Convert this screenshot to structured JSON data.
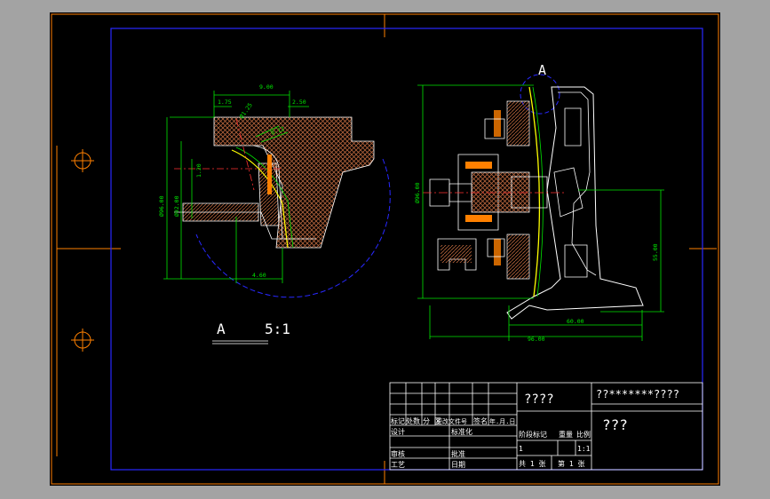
{
  "detail_view": {
    "label": "A",
    "scale": "5:1"
  },
  "section_marker": {
    "label": "A"
  },
  "dims_detail": {
    "d1": "1.75",
    "d2": "9.00",
    "d3": "2.50",
    "d4": "Ø1.25",
    "d5": "0.12",
    "d6": "1.20",
    "d7": "Ø96.00",
    "d8": "Ø92.00",
    "d9": "4.60"
  },
  "dims_main": {
    "dia": "Ø96.00",
    "h": "55.00",
    "w1": "60.00",
    "w2": "96.00"
  },
  "title_block": {
    "part_name": "????",
    "drawing_no": "??*******????",
    "company": "???",
    "rev_headers": [
      "标记",
      "处数",
      "分  区",
      "更改文件号",
      "签名",
      "年.月.日"
    ],
    "design": "设计",
    "standard": "标准化",
    "review": "审核",
    "process": "工艺",
    "approve": "批准",
    "date": "日期",
    "stage_label": "阶段标记",
    "weight_label": "重量",
    "scale_label": "比例",
    "stage_value": "1",
    "scale_value": "1:1",
    "sheets_total": "共 1 张",
    "sheet_no": "第 1 张"
  },
  "colors": {
    "sheet_border": "#ff8000",
    "frame": "#2828ff",
    "dimension": "#00e600",
    "hatch": "#b4643c",
    "outline": "#ffffff",
    "centerline": "#ff3030",
    "highlight": "#ffff00"
  }
}
